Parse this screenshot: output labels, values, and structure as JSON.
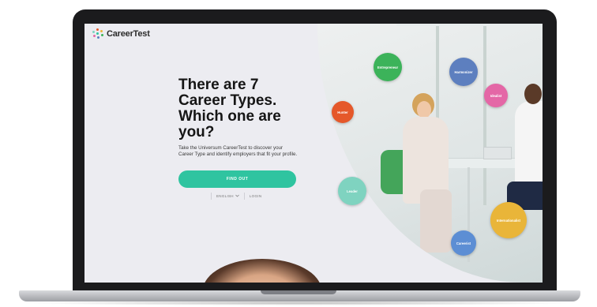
{
  "brand": {
    "name": "CareerTest",
    "accent": "#2fc4a0"
  },
  "hero": {
    "headline": "There are 7 Career Types. Which one are you?",
    "subtext": "Take the Universum CareerTest to discover your Career Type and identify employers that fit your profile.",
    "cta_label": "FIND OUT"
  },
  "footer_controls": {
    "language_label": "ENGLISH",
    "language_icon": "chevron-down-icon",
    "login_label": "LOGIN"
  },
  "career_types": [
    {
      "label": "Entrepreneur",
      "color": "#3cb35a"
    },
    {
      "label": "Harmonizer",
      "color": "#5d7fbf"
    },
    {
      "label": "Idealist",
      "color": "#e467a6"
    },
    {
      "label": "Hunter",
      "color": "#e5582a"
    },
    {
      "label": "Leader",
      "color": "#7fd3c0"
    },
    {
      "label": "Internationalist",
      "color": "#e9b539"
    },
    {
      "label": "Careerist",
      "color": "#5c8ed4"
    }
  ]
}
